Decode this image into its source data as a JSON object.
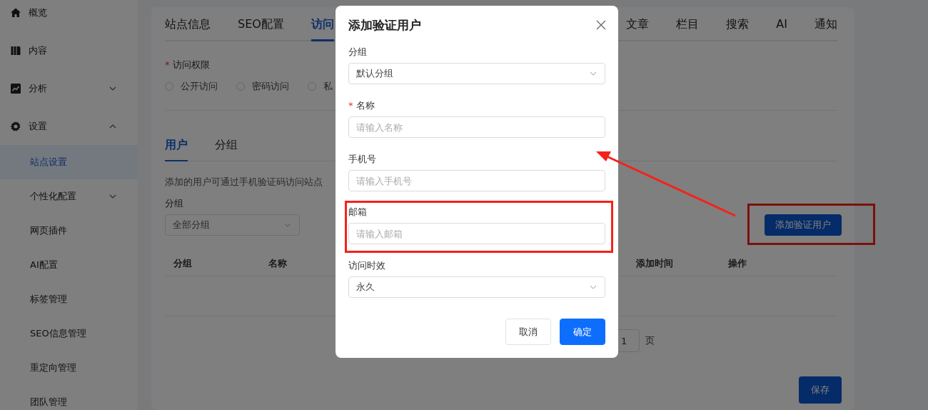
{
  "sidebar": {
    "items": [
      {
        "label": "概览",
        "kind": "link",
        "selected": false
      },
      {
        "label": "内容",
        "kind": "link",
        "selected": false
      },
      {
        "label": "分析",
        "kind": "menu",
        "expanded": false,
        "selected": false
      },
      {
        "label": "设置",
        "kind": "menu",
        "expanded": true,
        "selected": false,
        "children": [
          {
            "label": "站点设置",
            "kind": "link",
            "selected": true
          },
          {
            "label": "个性化配置",
            "kind": "menu",
            "expanded": false,
            "selected": false
          },
          {
            "label": "网页插件",
            "kind": "link",
            "selected": false
          },
          {
            "label": "AI配置",
            "kind": "link",
            "selected": false
          },
          {
            "label": "标签管理",
            "kind": "link",
            "selected": false
          },
          {
            "label": "SEO信息管理",
            "kind": "link",
            "selected": false
          },
          {
            "label": "重定向管理",
            "kind": "link",
            "selected": false
          },
          {
            "label": "团队管理",
            "kind": "link",
            "selected": false
          }
        ]
      }
    ]
  },
  "tabs": [
    {
      "label": "站点信息",
      "selected": false
    },
    {
      "label": "SEO配置",
      "selected": false
    },
    {
      "label": "访问",
      "selected": true
    },
    {
      "label": "文章",
      "selected": false
    },
    {
      "label": "栏目",
      "selected": false
    },
    {
      "label": "搜索",
      "selected": false
    },
    {
      "label": "AI",
      "selected": false
    },
    {
      "label": "通知",
      "selected": false
    }
  ],
  "access": {
    "label": "访问权限",
    "required_mark": "*",
    "options": [
      {
        "label": "公开访问",
        "selected": false
      },
      {
        "label": "密码访问",
        "selected": false
      },
      {
        "label": "私",
        "selected": false
      }
    ]
  },
  "subtabs": [
    {
      "label": "用户",
      "selected": true
    },
    {
      "label": "分组",
      "selected": false
    }
  ],
  "description": "添加的用户可通过手机验证码访问站点",
  "group_filter": {
    "label": "分组",
    "value": "全部分组"
  },
  "add_button": {
    "label": "添加验证用户",
    "highlighted": true
  },
  "table": {
    "columns": [
      "分组",
      "名称",
      "添加时间",
      "操作"
    ]
  },
  "pagination": {
    "page": "1",
    "unit": "页"
  },
  "save_button": "保存",
  "dialog": {
    "title": "添加验证用户",
    "fields": [
      {
        "label": "分组",
        "kind": "select",
        "value": "默认分组",
        "highlighted": false
      },
      {
        "label": "名称",
        "kind": "input",
        "placeholder": "请输入名称",
        "required_mark": "*",
        "highlighted": false
      },
      {
        "label": "手机号",
        "kind": "input",
        "placeholder": "请输入手机号",
        "highlighted": false
      },
      {
        "label": "邮箱",
        "kind": "input",
        "placeholder": "请输入邮箱",
        "highlighted": true
      },
      {
        "label": "访问时效",
        "kind": "select",
        "value": "永久",
        "highlighted": false
      }
    ],
    "buttons": [
      {
        "label": "取消",
        "kind": "default"
      },
      {
        "label": "确定",
        "kind": "primary"
      }
    ]
  },
  "callout_arrow": true
}
